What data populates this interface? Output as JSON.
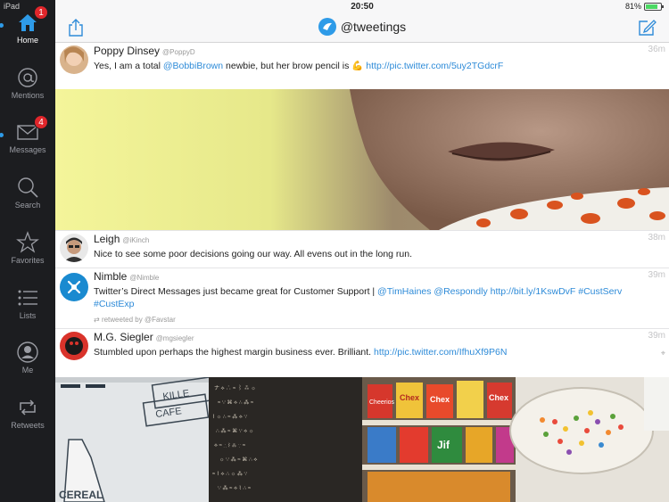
{
  "device_label": "iPad",
  "status": {
    "time": "20:50",
    "battery": "81%",
    "battery_level": 0.81
  },
  "header": {
    "account": "@tweetings"
  },
  "sidebar": {
    "items": [
      {
        "label": "Home",
        "icon": "home-icon",
        "badge": "1",
        "active": true
      },
      {
        "label": "Mentions",
        "icon": "at-icon",
        "badge": "",
        "active": false
      },
      {
        "label": "Messages",
        "icon": "envelope-icon",
        "badge": "4",
        "active": false
      },
      {
        "label": "Search",
        "icon": "search-icon",
        "badge": "",
        "active": false
      },
      {
        "label": "Favorites",
        "icon": "star-icon",
        "badge": "",
        "active": false
      },
      {
        "label": "Lists",
        "icon": "list-icon",
        "badge": "",
        "active": false
      },
      {
        "label": "Me",
        "icon": "profile-icon",
        "badge": "",
        "active": false
      },
      {
        "label": "Retweets",
        "icon": "retweet-icon",
        "badge": "",
        "active": false
      }
    ]
  },
  "tweets": [
    {
      "name": "Poppy Dinsey",
      "handle": "@PoppyD",
      "time": "36m",
      "text_before": "Yes, I am a total ",
      "mention": "@BobbiBrown",
      "text_after": " newbie, but her brow pencil is 💪 ",
      "link": "http://pic.twitter.com/5uy2TGdcrF"
    },
    {
      "name": "Leigh",
      "handle": "@iKinch",
      "time": "38m",
      "text": "Nice to see some poor decisions going our way. All evens out in the long run."
    },
    {
      "name": "Nimble",
      "handle": "@Nimble",
      "time": "39m",
      "text_before": "Twitter’s Direct Messages just became great for Customer Support | ",
      "links": [
        "@TimHaines",
        "@Respondly",
        "http://bit.ly/1KswDvF",
        "#CustServ",
        "#CustExp"
      ],
      "retweeted_by": "retweeted by @Favstar"
    },
    {
      "name": "M.G. Siegler",
      "handle": "@mgsiegler",
      "time": "39m",
      "text_before": "Stumbled upon perhaps the highest margin business ever. Brilliant. ",
      "link": "http://pic.twitter.com/IfhuXf9P6N"
    }
  ],
  "media2_sign": {
    "line1": "KILLE",
    "line2": "CAFE",
    "bottle": "CEREAL"
  },
  "cereal_labels": [
    "Chex",
    "Chex",
    "Cheerios",
    "Jif",
    "Chex"
  ],
  "colors": {
    "accent": "#2e9be8",
    "badge": "#e0262b",
    "sidebar": "#1c1d20"
  }
}
